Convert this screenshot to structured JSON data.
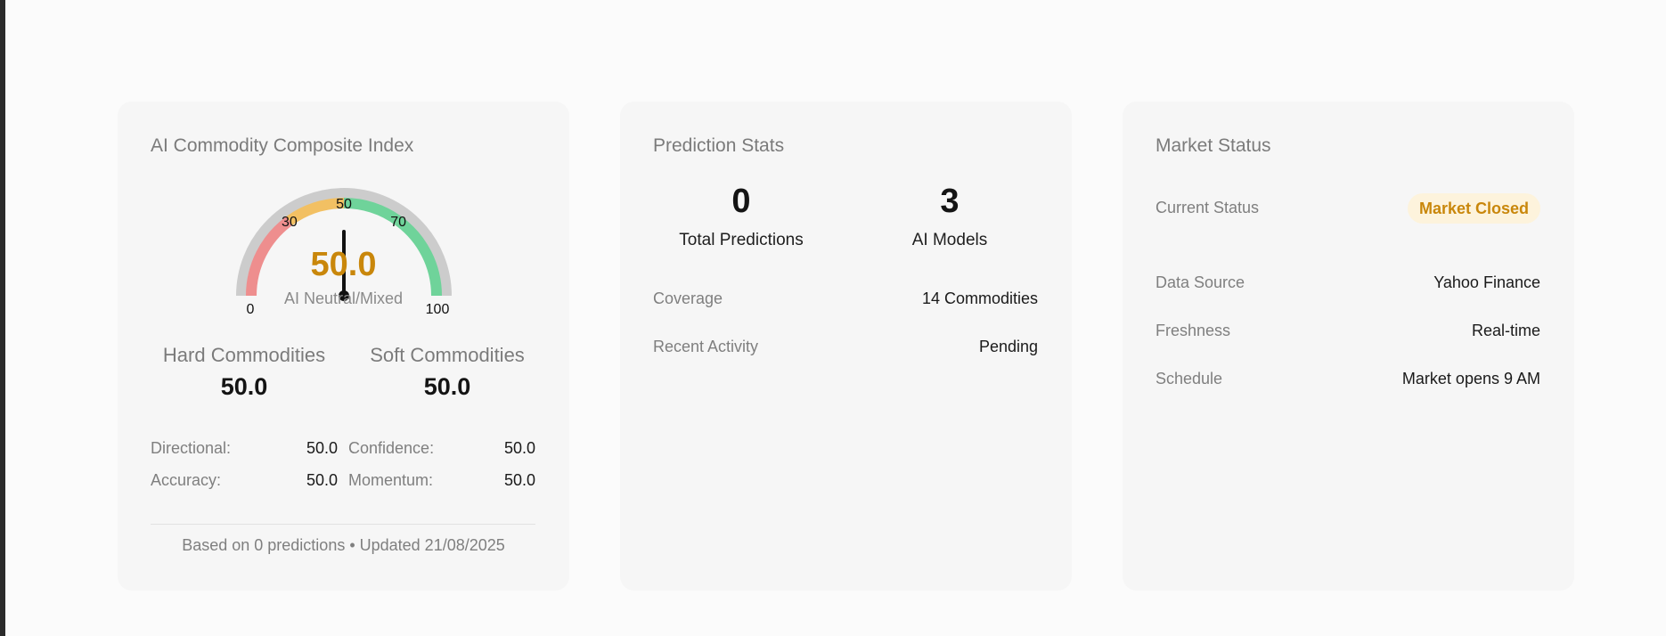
{
  "composite": {
    "title": "AI Commodity Composite Index",
    "gauge": {
      "value": 50.0,
      "value_text": "50.0",
      "label": "AI Neutral/Mixed",
      "min": 0,
      "max": 100,
      "ticks": [
        "0",
        "30",
        "50",
        "70",
        "100"
      ],
      "zone_colors": {
        "bearish": "#ee8e8e",
        "neutral": "#f2c063",
        "bullish": "#6fd39a",
        "track": "#cccccc",
        "value": "#c9870b"
      }
    },
    "hard": {
      "label": "Hard Commodities",
      "value": "50.0"
    },
    "soft": {
      "label": "Soft Commodities",
      "value": "50.0"
    },
    "metrics": [
      {
        "label": "Directional:",
        "value": "50.0"
      },
      {
        "label": "Confidence:",
        "value": "50.0"
      },
      {
        "label": "Accuracy:",
        "value": "50.0"
      },
      {
        "label": "Momentum:",
        "value": "50.0"
      }
    ],
    "footer": "Based on 0 predictions • Updated 21/08/2025"
  },
  "prediction": {
    "title": "Prediction Stats",
    "total": {
      "value": "0",
      "label": "Total Predictions"
    },
    "models": {
      "value": "3",
      "label": "AI Models"
    },
    "rows": [
      {
        "label": "Coverage",
        "value": "14 Commodities"
      },
      {
        "label": "Recent Activity",
        "value": "Pending"
      }
    ]
  },
  "market": {
    "title": "Market Status",
    "status_label": "Current Status",
    "status_badge": "Market Closed",
    "rows": [
      {
        "label": "Data Source",
        "value": "Yahoo Finance"
      },
      {
        "label": "Freshness",
        "value": "Real-time"
      },
      {
        "label": "Schedule",
        "value": "Market opens 9 AM"
      }
    ]
  }
}
